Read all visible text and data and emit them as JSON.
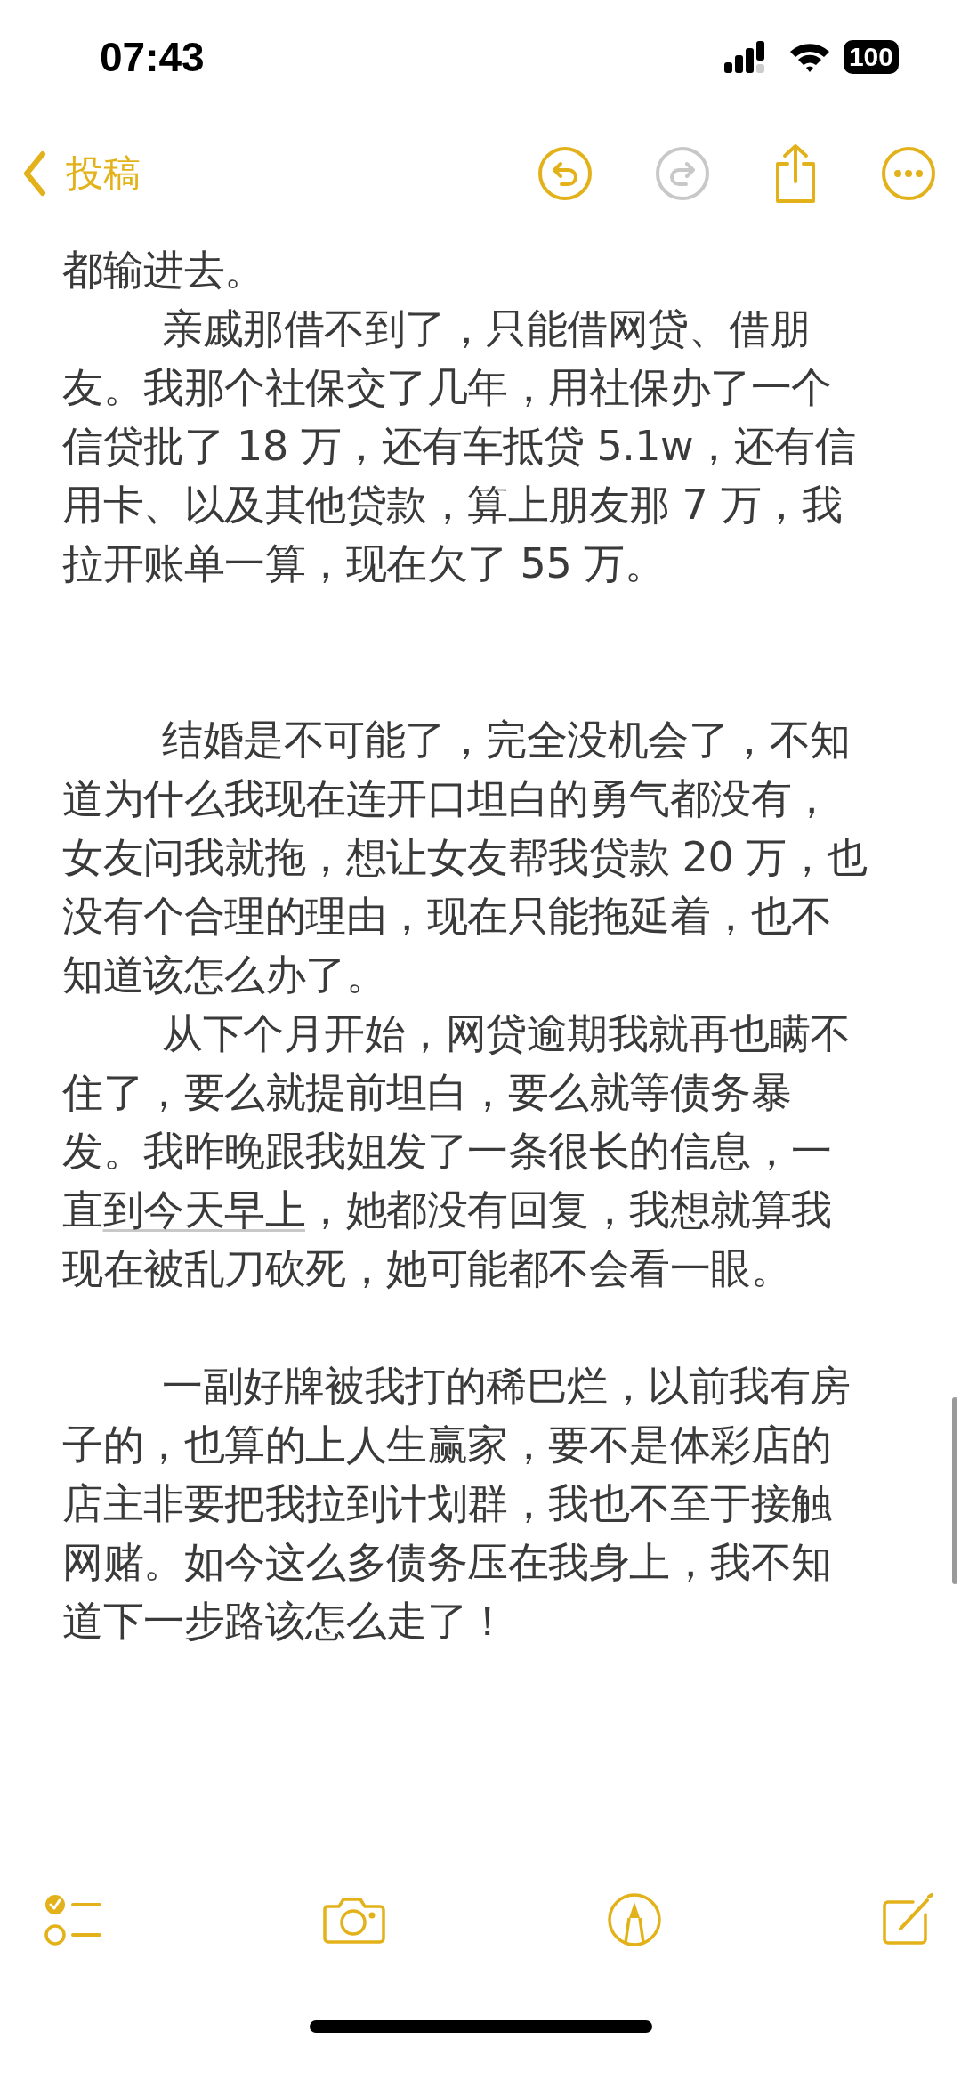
{
  "status_bar": {
    "time": "07:43",
    "battery": "100"
  },
  "nav": {
    "back_label": "投稿",
    "undo": {
      "disabled": false
    },
    "redo": {
      "disabled": true
    }
  },
  "note": {
    "paragraphs": [
      {
        "kind": "text",
        "indent": false,
        "parts": [
          {
            "text": "都输进去。",
            "underlined": false
          }
        ]
      },
      {
        "kind": "text",
        "indent": true,
        "parts": [
          {
            "text": "亲戚那借不到了，只能借网贷、借朋友。我那个社保交了几年，用社保办了一个信贷批了 18 万，还有车抵贷 5.1w，还有信用卡、以及其他贷款，算上朋友那 7 万，我拉开账单一算，现在欠了 55 万。",
            "underlined": false
          }
        ]
      },
      {
        "kind": "blank"
      },
      {
        "kind": "blank"
      },
      {
        "kind": "text",
        "indent": true,
        "parts": [
          {
            "text": "结婚是不可能了，完全没机会了，不知道为什么我现在连开口坦白的勇气都没有，女友问我就拖，想让女友帮我贷款 20 万，也没有个合理的理由，现在只能拖延着，也不知道该怎么办了。",
            "underlined": false
          }
        ]
      },
      {
        "kind": "text",
        "indent": true,
        "parts": [
          {
            "text": "从下个月开始，网贷逾期我就再也瞒不住了，要么就提前坦白，要么就等债务暴发。我昨晚跟我姐发了一条很长的信息，一直",
            "underlined": false
          },
          {
            "text": "到今天早上",
            "underlined": true
          },
          {
            "text": "，她都没有回复，我想就算我现在被乱刀砍死，她可能都不会看一眼。",
            "underlined": false
          }
        ]
      },
      {
        "kind": "blank"
      },
      {
        "kind": "text",
        "indent": true,
        "parts": [
          {
            "text": "一副好牌被我打的稀巴烂，以前我有房子的，也算的上人生赢家，要不是体彩店的店主非要把我拉到计划群，我也不至于接触网赌。如今这么多债务压在我身上，我不知道下一步路该怎么走了！",
            "underlined": false
          }
        ]
      }
    ]
  }
}
